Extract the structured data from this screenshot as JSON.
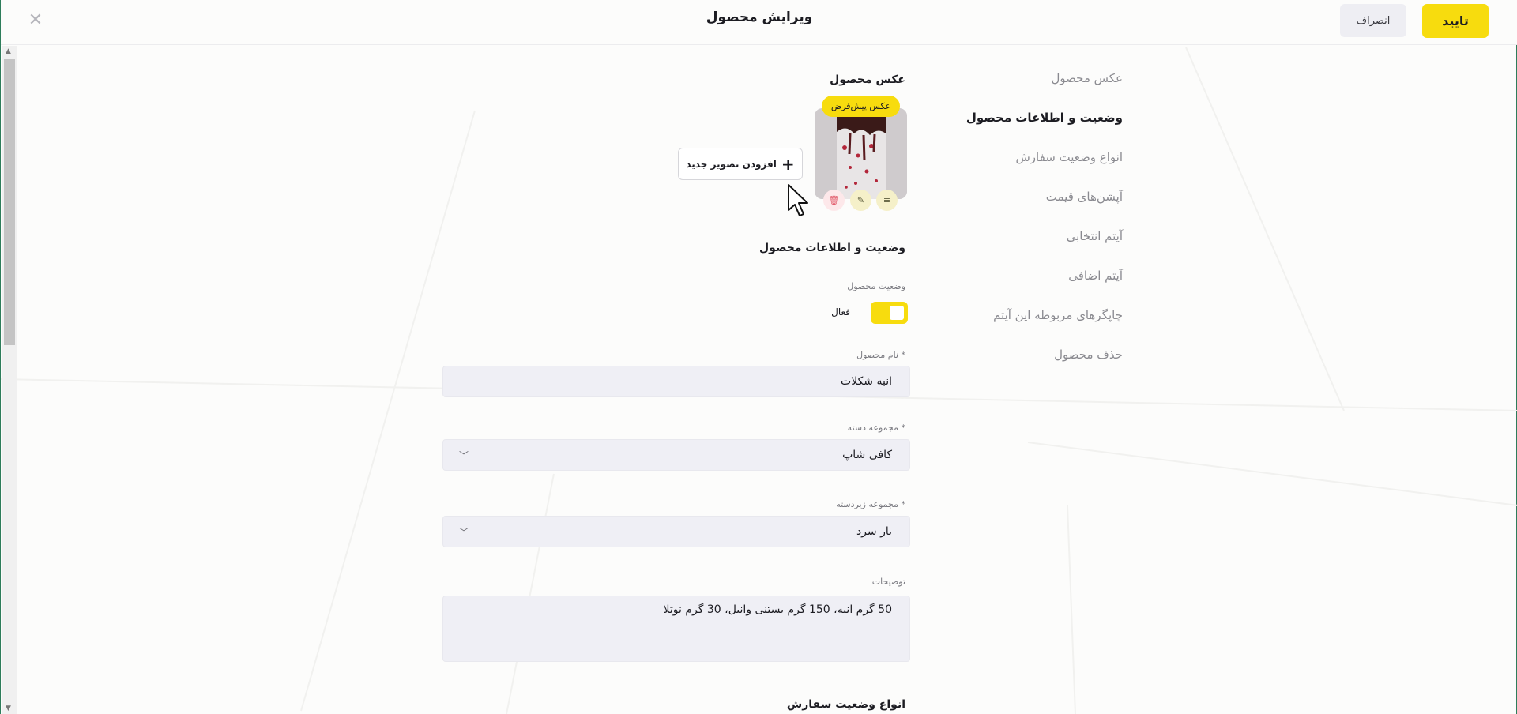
{
  "header": {
    "title": "ویرایش محصول",
    "confirm_label": "تایید",
    "cancel_label": "انصراف",
    "close_icon": "close-icon"
  },
  "side_nav": {
    "items": [
      {
        "label": "عکس محصول",
        "active": false
      },
      {
        "label": "وضعیت و اطلاعات محصول",
        "active": true
      },
      {
        "label": "انواع وضعیت سفارش",
        "active": false
      },
      {
        "label": "آپشن‌های قیمت",
        "active": false
      },
      {
        "label": "آیتم انتخابی",
        "active": false
      },
      {
        "label": "آیتم اضافی",
        "active": false
      },
      {
        "label": "چاپگرهای مربوطه این آیتم",
        "active": false
      },
      {
        "label": "حذف محصول",
        "active": false
      }
    ]
  },
  "photo_section": {
    "title": "عکس محصول",
    "default_badge": "عکس پیش‌فرض",
    "add_image_label": "افزودن تصویر جدید"
  },
  "info_section": {
    "title": "وضعیت و اطلاعات محصول",
    "status_label": "وضعیت محصول",
    "status_value": "فعال",
    "name_label": "نام محصول *",
    "name_value": "انبه شکلات",
    "category_label": "مجموعه دسته *",
    "category_value": "کافی شاپ",
    "subcategory_label": "مجموعه زیردسته *",
    "subcategory_value": "بار سرد",
    "description_label": "توضیحات",
    "description_value": "50 گرم انبه،  150 گرم بستنی وانیل، 30 گرم نوتلا"
  },
  "order_section": {
    "title": "انواع وضعیت سفارش"
  },
  "colors": {
    "accent": "#f7dc0e",
    "input_bg": "#efeff5"
  }
}
